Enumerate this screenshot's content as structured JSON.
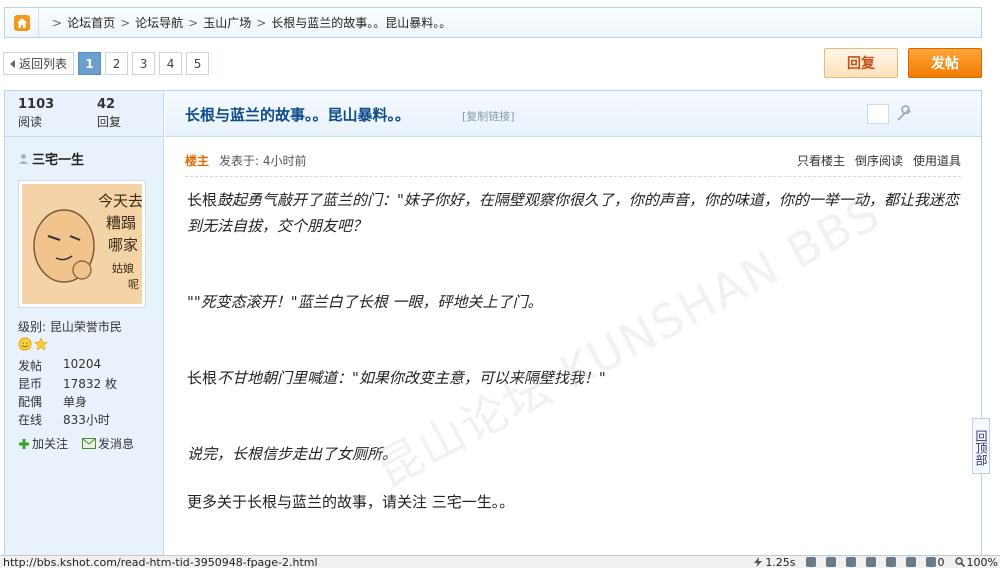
{
  "breadcrumb": {
    "items": [
      "论坛首页",
      "论坛导航",
      "玉山广场",
      "长根与蓝兰的故事。。昆山暴料。。"
    ],
    "separator": ">"
  },
  "pager": {
    "back_label": "返回列表",
    "pages": [
      "1",
      "2",
      "3",
      "4",
      "5"
    ],
    "current": "1"
  },
  "buttons": {
    "reply": "回复",
    "post": "发帖"
  },
  "stats": {
    "views": "1103",
    "views_label": "阅读",
    "replies": "42",
    "replies_label": "回复"
  },
  "thread": {
    "title": "长根与蓝兰的故事。。昆山暴料。。",
    "copy_link": "[复制链接]"
  },
  "user": {
    "name": "三宅一生",
    "level": "级别: 昆山荣誉市民",
    "fields": [
      {
        "k": "发帖",
        "v": "10204"
      },
      {
        "k": "昆币",
        "v": "17832 枚"
      },
      {
        "k": "配偶",
        "v": "单身"
      },
      {
        "k": "在线",
        "v": "833小时"
      }
    ],
    "follow": "加关注",
    "message": "发消息",
    "avatar_text": [
      "今天去",
      "糟蹋",
      "哪家",
      "姑娘",
      "呢"
    ]
  },
  "meta": {
    "owner": "楼主",
    "posted": "发表于: 4小时前",
    "links": [
      "只看楼主",
      "倒序阅读",
      "使用道具"
    ]
  },
  "content": {
    "p1a": "长根",
    "p1b": "鼓起勇气敲开了蓝兰的门：\"妹子你好，在隔壁观察你很久了，你的声音，你的味道，你的一举一动，都让我迷恋到无法自拔，交个朋友吧？",
    "p2": "\"\"死变态滚开！\"蓝兰白了长根 一眼，砰地关上了门。",
    "p3a": "长根",
    "p3b": "不甘地朝门里喊道：\"如果你改变主意，可以来隔壁找我！\"",
    "p4": "说完，长根信步走出了女厕所。",
    "p5": "更多关于长根与蓝兰的故事，请关注 三宅一生。。"
  },
  "watermark": "昆山论坛 KUNSHAN BBS",
  "backtop": "回顶部",
  "status": {
    "url": "http://bbs.kshot.com/read-htm-tid-3950948-fpage-2.html",
    "time": "1.25s",
    "count": "0",
    "zoom": "100%"
  },
  "colors": {
    "link_blue": "#0d4b8a",
    "owner_orange": "#e36c09",
    "post_button": "#f07c00",
    "current_page": "#6b9fcd"
  }
}
